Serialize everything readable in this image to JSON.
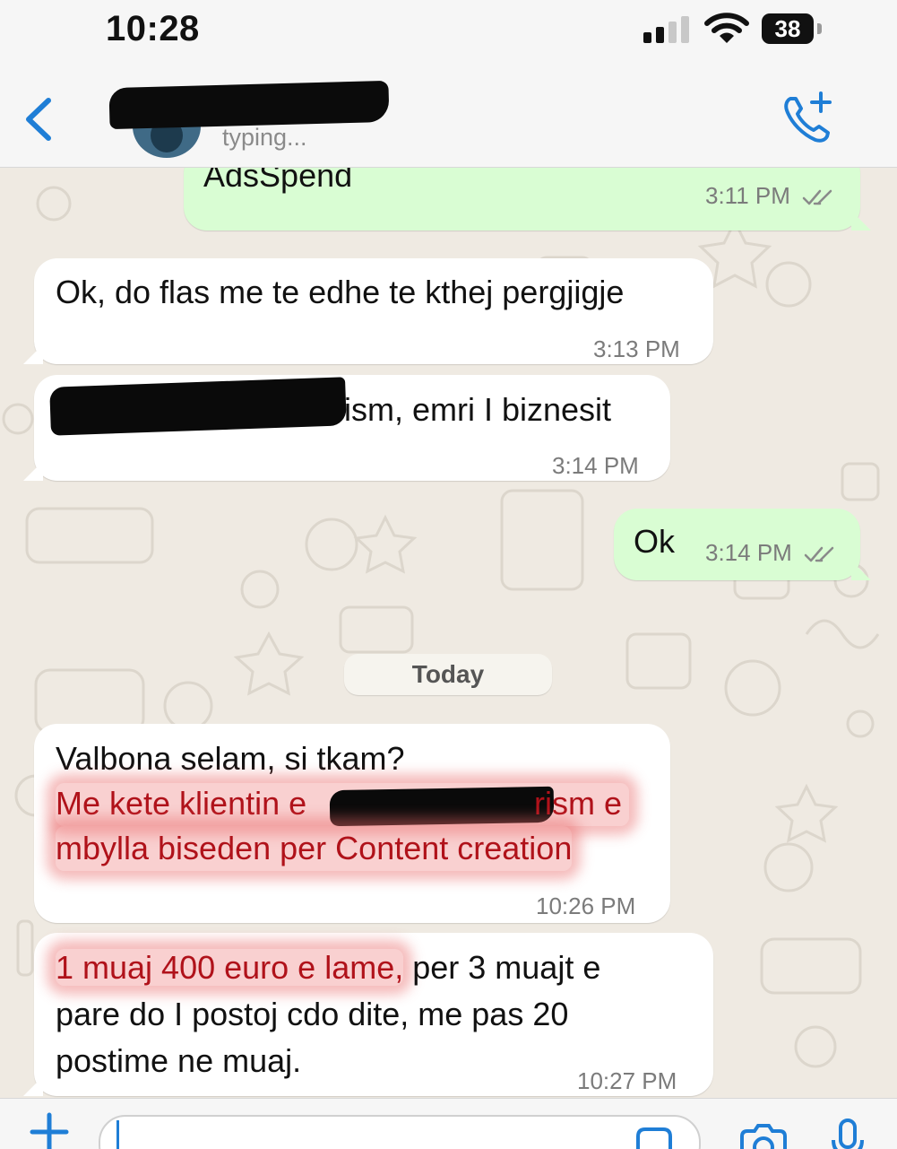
{
  "status_bar": {
    "time": "10:28",
    "battery": "38"
  },
  "header": {
    "contact_status": "typing..."
  },
  "messages": [
    {
      "direction": "out",
      "text": "AdsSpend",
      "time": "3:11 PM",
      "read": true
    },
    {
      "direction": "in",
      "text": "Ok, do flas me te edhe te kthej pergjigje",
      "time": "3:13 PM"
    },
    {
      "direction": "in",
      "text_visible": "ism, emri I biznesit",
      "time": "3:14 PM"
    },
    {
      "direction": "out",
      "text": "Ok",
      "time": "3:14 PM",
      "read": true
    },
    {
      "direction": "in",
      "line1": "Valbona selam, si tkam?",
      "line2_start": "Me kete klientin e",
      "line2_end": "rism e",
      "line3": "mbylla biseden per Content creation",
      "time": "10:26 PM"
    },
    {
      "direction": "in",
      "highlight": "1 muaj 400 euro e lame,",
      "rest1": " per 3 muajt e",
      "line2": "pare do I postoj cdo dite, me pas 20",
      "line3": "postime ne muaj.",
      "time": "10:27 PM"
    }
  ],
  "date_divider": "Today",
  "colors": {
    "outgoing": "#d9fdd3",
    "incoming": "#ffffff",
    "accent": "#1f7ed6",
    "highlight": "#e86868"
  }
}
